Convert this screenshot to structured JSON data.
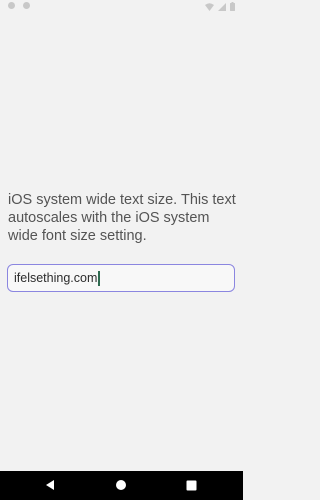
{
  "status_bar": {
    "left_icons": [
      "status-dot-icon",
      "status-dot-icon"
    ],
    "right_icons": [
      "wifi-icon",
      "signal-icon",
      "battery-icon"
    ]
  },
  "main": {
    "description": "iOS system wide text size. This text autoscales with the iOS system wide font size setting.",
    "input": {
      "value": "ifelsething.com",
      "border_color": "#8b86e0"
    }
  },
  "nav_bar": {
    "buttons": [
      "back-icon",
      "home-icon",
      "recents-icon"
    ]
  }
}
